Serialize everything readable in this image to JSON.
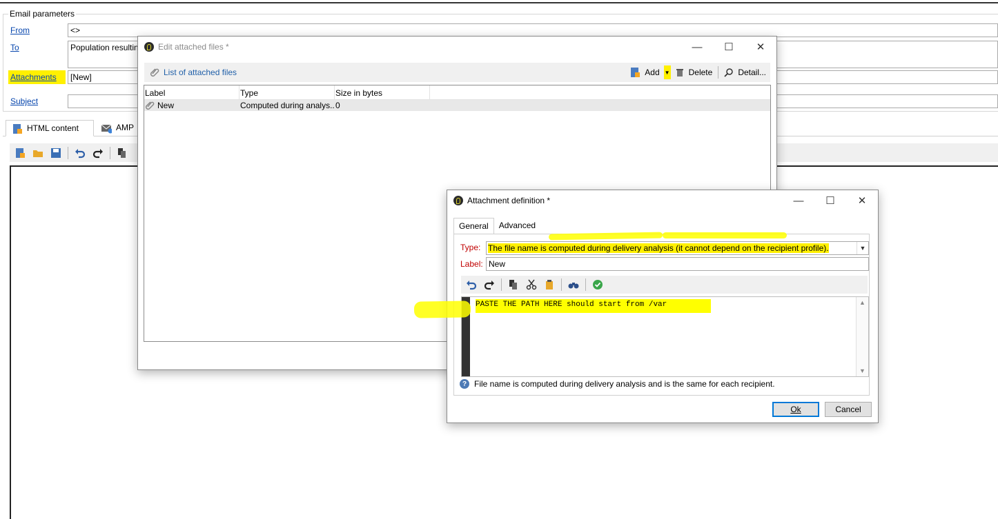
{
  "email_params": {
    "legend": "Email parameters",
    "from_label": "From",
    "from_value": "<>",
    "to_label": "To",
    "to_value": "Population resultin",
    "attachments_label": "Attachments",
    "attachments_value": "[New]",
    "subject_label": "Subject",
    "subject_value": ""
  },
  "content_tabs": [
    {
      "label": "HTML content",
      "icon": "html-content-icon"
    },
    {
      "label": "AMP",
      "icon": "amp-icon"
    }
  ],
  "edit_attached": {
    "title": "Edit attached files *",
    "list_label": "List of attached files",
    "add_label": "Add",
    "delete_label": "Delete",
    "detail_label": "Detail...",
    "columns": [
      "Label",
      "Type",
      "Size in bytes"
    ],
    "rows": [
      {
        "label": "New",
        "type": "Computed during analys..",
        "size": "0"
      }
    ]
  },
  "attachment_def": {
    "title": "Attachment definition *",
    "tabs": [
      "General",
      "Advanced"
    ],
    "type_label": "Type:",
    "type_value": "The file name is computed during delivery analysis (it cannot depend on the recipient profile).",
    "label_label": "Label:",
    "label_value": "New",
    "code_text": "PASTE THE PATH HERE should start from /var",
    "info_text": "File name is computed during delivery analysis and is the same for each recipient.",
    "ok_label": "Ok",
    "cancel_label": "Cancel"
  },
  "colors": {
    "highlight": "#fff000",
    "link": "#0645ad",
    "required_label": "#c00000",
    "default_button_border": "#0078d7"
  }
}
